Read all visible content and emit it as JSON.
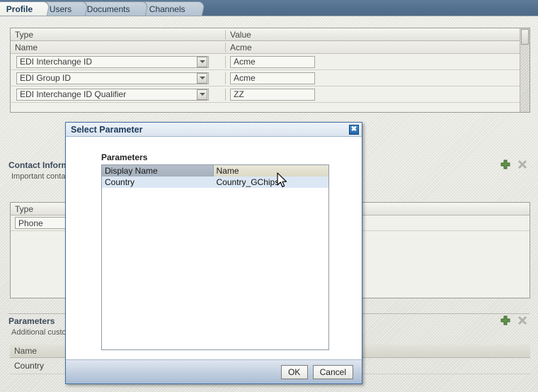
{
  "tabs": [
    {
      "label": "Profile",
      "active": true
    },
    {
      "label": "Users",
      "active": false
    },
    {
      "label": "Documents",
      "active": false
    },
    {
      "label": "Channels",
      "active": false
    }
  ],
  "profile_grid": {
    "headers": {
      "type": "Type",
      "value": "Value"
    },
    "summary_row": {
      "type": "Name",
      "value": "Acme"
    },
    "rows": [
      {
        "type": "EDI Interchange ID",
        "value": "Acme"
      },
      {
        "type": "EDI Group ID",
        "value": "Acme"
      },
      {
        "type": "EDI Interchange ID Qualifier",
        "value": "ZZ"
      }
    ]
  },
  "contact_section": {
    "title": "Contact Information",
    "subtitle": "Important contact",
    "headers": {
      "type": "Type"
    },
    "rows": [
      {
        "type": "Phone"
      }
    ],
    "add_label": "+",
    "delete_label": "×"
  },
  "parameters_section": {
    "title": "Parameters",
    "subtitle": "Additional custom",
    "header": "Name",
    "rows": [
      "Country"
    ],
    "add_label": "+",
    "delete_label": "×"
  },
  "dialog": {
    "title": "Select Parameter",
    "close_label": "✖",
    "params_label": "Parameters",
    "table": {
      "columns": [
        "Display Name",
        "Name"
      ],
      "rows": [
        {
          "display_name": "Country",
          "name": "Country_GChips",
          "selected": true
        }
      ]
    },
    "ok_label": "OK",
    "cancel_label": "Cancel"
  },
  "colors": {
    "header_blue": "#53708f",
    "dialog_border": "#3f6f9f",
    "selected_row": "#dbe7f3",
    "accent_green": "#4f7a3a"
  }
}
